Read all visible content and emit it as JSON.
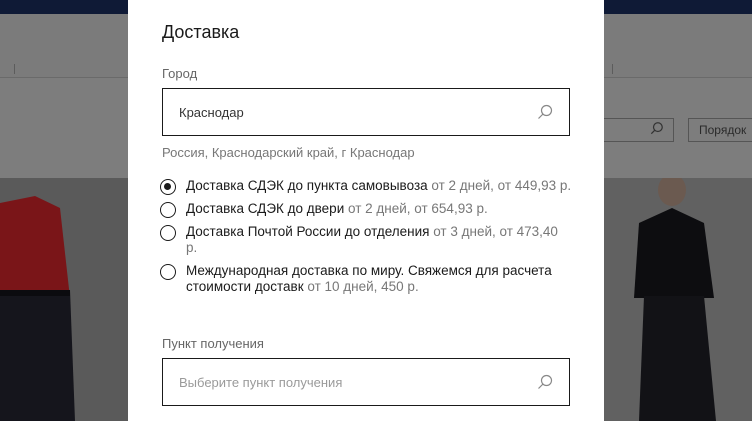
{
  "background": {
    "sort_label": "Порядок"
  },
  "modal": {
    "title": "Доставка",
    "city_label": "Город",
    "city_value": "Краснодар",
    "city_hint": "Россия, Краснодарский край, г Краснодар",
    "options": [
      {
        "name": "Доставка СДЭК до пункта самовывоза",
        "meta": " от 2 дней, от 449,93 р.",
        "selected": true
      },
      {
        "name": "Доставка СДЭК до двери",
        "meta": " от 2 дней, от 654,93 р.",
        "selected": false
      },
      {
        "name": "Доставка Почтой России до отделения",
        "meta": " от 3 дней, от 473,40 р.",
        "selected": false
      },
      {
        "name": "Международная доставка по миру. Свяжемся для расчета стоимости доставк",
        "meta": " от 10 дней, 450 р.",
        "selected": false
      }
    ],
    "pickup_label": "Пункт получения",
    "pickup_placeholder": "Выберите пункт получения"
  }
}
